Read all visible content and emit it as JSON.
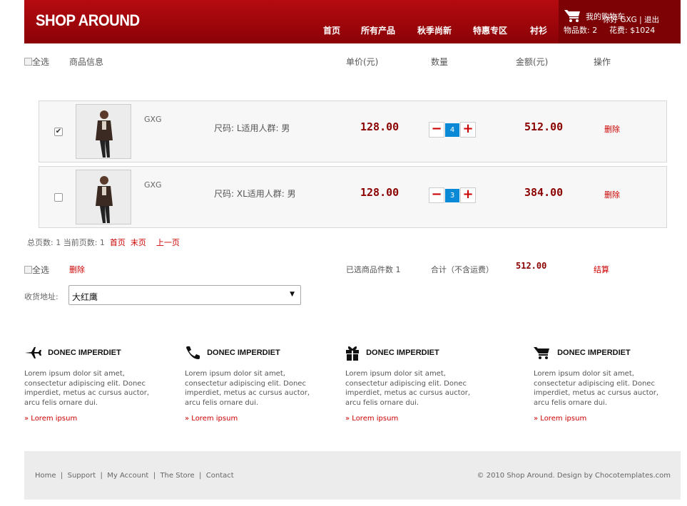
{
  "header": {
    "logo": "SHOP AROUND",
    "nav": [
      "首页",
      "所有产品",
      "秋季尚新",
      "特惠专区",
      "衬衫"
    ],
    "cart": {
      "line1": "我的购物车",
      "welcome": "你好 GXG | 退出",
      "items_label": "物品数: 2",
      "total_label": "花费: $1024"
    }
  },
  "table": {
    "headers": {
      "select_all": "全选",
      "product_info": "商品信息",
      "unit_price": "单价(元)",
      "quantity": "数量",
      "amount": "金额(元)",
      "action": "操作"
    },
    "rows": [
      {
        "checked": true,
        "brand": "GXG",
        "spec": "尺码: L适用人群: 男",
        "price": "128.00",
        "qty": "4",
        "amount": "512.00",
        "delete": "删除"
      },
      {
        "checked": false,
        "brand": "GXG",
        "spec": "尺码: XL适用人群: 男",
        "price": "128.00",
        "qty": "3",
        "amount": "384.00",
        "delete": "删除"
      }
    ]
  },
  "pager": {
    "total_pages": "总页数: 1",
    "current_page": "当前页数: 1",
    "first": "首页",
    "last": "末页",
    "prev": "上一页"
  },
  "summary": {
    "select_all": "全选",
    "delete": "删除",
    "selected_count": "已选商品件数 1",
    "total_label": "合计（不含运费）",
    "total_value": "512.00",
    "checkout": "结算"
  },
  "address": {
    "label": "收货地址:",
    "value": "大红鹰"
  },
  "features": [
    {
      "icon": "airplane-icon",
      "title": "DONEC IMPERDIET",
      "text": "Lorem ipsum dolor sit amet, consectetur adipiscing elit. Donec imperdiet, metus ac cursus auctor, arcu felis ornare dui.",
      "link": "» Lorem ipsum"
    },
    {
      "icon": "phone-icon",
      "title": "DONEC IMPERDIET",
      "text": "Lorem ipsum dolor sit amet, consectetur adipiscing elit. Donec imperdiet, metus ac cursus auctor, arcu felis ornare dui.",
      "link": "» Lorem ipsum"
    },
    {
      "icon": "gift-icon",
      "title": "DONEC IMPERDIET",
      "text": "Lorem ipsum dolor sit amet, consectetur adipiscing elit. Donec imperdiet, metus ac cursus auctor, arcu felis ornare dui.",
      "link": "» Lorem ipsum"
    },
    {
      "icon": "cart-icon",
      "title": "DONEC IMPERDIET",
      "text": "Lorem ipsum dolor sit amet, consectetur adipiscing elit. Donec imperdiet, metus ac cursus auctor, arcu felis ornare dui.",
      "link": "» Lorem ipsum"
    }
  ],
  "footer": {
    "links": [
      "Home",
      "Support",
      "My Account",
      "The Store",
      "Contact"
    ],
    "copyright": "© 2010 Shop Around. Design by Chocotemplates.com"
  },
  "colors": {
    "header_red": "#a0060b",
    "price_red": "#8b0000",
    "link_red": "#cc0000",
    "qty_blue": "#0a8ad6"
  }
}
